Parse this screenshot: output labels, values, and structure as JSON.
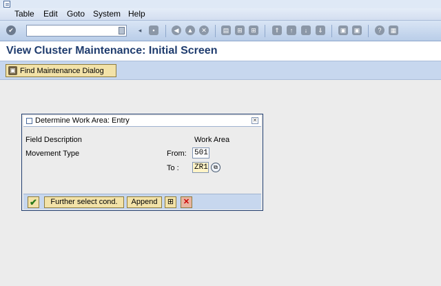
{
  "menu": {
    "items": [
      "Table",
      "Edit",
      "Goto",
      "System",
      "Help"
    ]
  },
  "toolbar": {
    "command_field_value": "",
    "icons": [
      "enter-icon",
      "save-icon",
      "back-icon",
      "exit-icon",
      "cancel-icon",
      "print-icon",
      "find-icon",
      "find-next-icon",
      "first-page-icon",
      "previous-page-icon",
      "next-page-icon",
      "last-page-icon",
      "new-session-icon",
      "shortcut-icon",
      "help-icon",
      "layout-icon"
    ]
  },
  "page": {
    "title": "View Cluster Maintenance: Initial Screen"
  },
  "app_toolbar": {
    "find_button_label": "Find Maintenance Dialog"
  },
  "dialog": {
    "title": "Determine Work Area: Entry",
    "field_description_header": "Field Description",
    "work_area_header": "Work Area",
    "field_label": "Movement Type",
    "from_label": "From:",
    "from_value": "501",
    "to_label": "To :",
    "to_value": "ZR1",
    "buttons": {
      "further_select": "Further select cond.",
      "append": "Append"
    }
  },
  "colors": {
    "title_blue": "#1f3c6e",
    "button_yellow": "#f2e2a8",
    "toolbar_blue": "#c7d7ee"
  }
}
